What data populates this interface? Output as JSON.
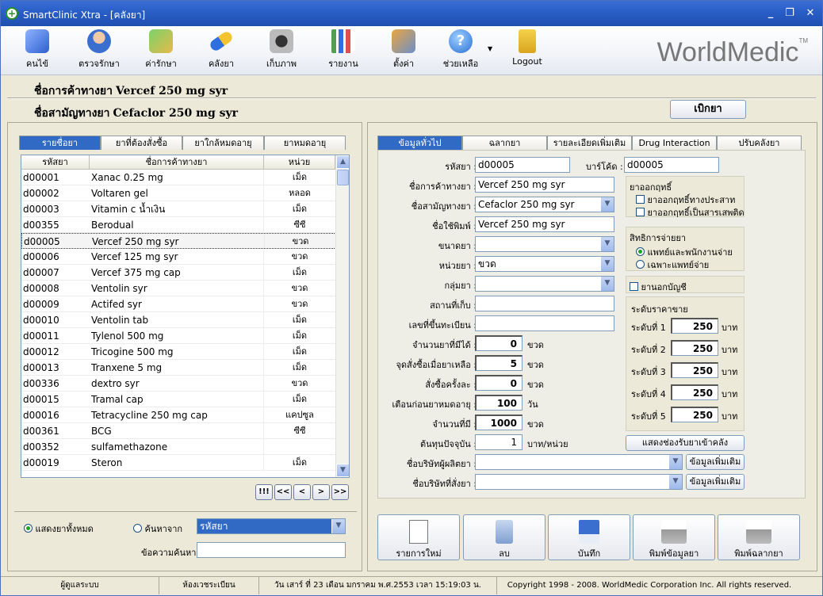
{
  "window": {
    "title": "SmartClinic Xtra - [คลังยา]"
  },
  "toolbar": {
    "items": [
      {
        "label": "คนไข้",
        "icon": "patient-book-icon"
      },
      {
        "label": "ตรวจรักษา",
        "icon": "doctor-icon"
      },
      {
        "label": "ค่ารักษา",
        "icon": "money-icon"
      },
      {
        "label": "คลังยา",
        "icon": "pill-icon"
      },
      {
        "label": "เก็บภาพ",
        "icon": "camera-icon"
      },
      {
        "label": "รายงาน",
        "icon": "bar-chart-icon"
      },
      {
        "label": "ตั้งค่า",
        "icon": "settings-icon"
      },
      {
        "label": "ช่วยเหลือ",
        "icon": "help-icon"
      },
      {
        "label": "Logout",
        "icon": "lock-icon"
      }
    ],
    "logo": "WorldMedic",
    "logo_tm": "TM"
  },
  "header": {
    "trade_label": "ชื่อการค้าทางยา",
    "trade_value": "Vercef 250 mg syr",
    "generic_label": "ชื่อสามัญทางยา",
    "generic_value": "Cefaclor 250 mg syr",
    "dispense_button": "เบิกยา"
  },
  "left": {
    "tabs": [
      "รายชื่อยา",
      "ยาที่ต้องสั่งซื้อ",
      "ยาใกล้หมดอายุ",
      "ยาหมดอายุ"
    ],
    "columns": [
      "รหัสยา",
      "ชื่อการค้าทางยา",
      "หน่วย"
    ],
    "rows": [
      {
        "code": "d00001",
        "name": "Xanac 0.25 mg",
        "unit": "เม็ด"
      },
      {
        "code": "d00002",
        "name": "Voltaren gel",
        "unit": "หลอด"
      },
      {
        "code": "d00003",
        "name": "Vitamin c น้ำเงิน",
        "unit": "เม็ด"
      },
      {
        "code": "d00355",
        "name": "Berodual",
        "unit": "ซีซี"
      },
      {
        "code": "d00005",
        "name": "Vercef 250 mg syr",
        "unit": "ขวด"
      },
      {
        "code": "d00006",
        "name": "Vercef 125 mg syr",
        "unit": "ขวด"
      },
      {
        "code": "d00007",
        "name": "Vercef 375 mg cap",
        "unit": "เม็ด"
      },
      {
        "code": "d00008",
        "name": "Ventolin syr",
        "unit": "ขวด"
      },
      {
        "code": "d00009",
        "name": "Actifed syr",
        "unit": "ขวด"
      },
      {
        "code": "d00010",
        "name": "Ventolin tab",
        "unit": "เม็ด"
      },
      {
        "code": "d00011",
        "name": "Tylenol 500 mg",
        "unit": "เม็ด"
      },
      {
        "code": "d00012",
        "name": "Tricogine 500 mg",
        "unit": "เม็ด"
      },
      {
        "code": "d00013",
        "name": "Tranxene 5 mg",
        "unit": "เม็ด"
      },
      {
        "code": "d00336",
        "name": "dextro syr",
        "unit": "ขวด"
      },
      {
        "code": "d00015",
        "name": "Tramal cap",
        "unit": "เม็ด"
      },
      {
        "code": "d00016",
        "name": "Tetracycline 250 mg cap",
        "unit": "แคปซูล"
      },
      {
        "code": "d00361",
        "name": "BCG",
        "unit": "ซีซี"
      },
      {
        "code": "d00352",
        "name": "sulfamethazone",
        "unit": ""
      },
      {
        "code": "d00019",
        "name": "Steron",
        "unit": "เม็ด"
      }
    ],
    "selected_index": 4,
    "nav": [
      "!!!",
      "<<",
      "<",
      ">",
      ">>"
    ],
    "show_all_label": "แสดงยาทั้งหมด",
    "search_from_label": "ค้นหาจาก",
    "search_from_value": "รหัสยา",
    "search_text_label": "ข้อความค้นหา",
    "search_text_value": ""
  },
  "right": {
    "tabs": [
      "ข้อมูลทั่วไป",
      "ฉลากยา",
      "รายละเอียดเพิ่มเติม",
      "Drug Interaction",
      "ปรับคลังยา"
    ],
    "fields": {
      "code_label": "รหัสยา :",
      "code_value": "d00005",
      "barcode_label": "บาร์โค้ด :",
      "barcode_value": "d00005",
      "trade_label": "ชื่อการค้าทางยา :",
      "trade_value": "Vercef 250 mg syr",
      "generic_label": "ชื่อสามัญทางยา :",
      "generic_value": "Cefaclor 250 mg syr",
      "print_label": "ชื่อใช้พิมพ์ :",
      "print_value": "Vercef 250 mg syr",
      "size_label": "ขนาดยา :",
      "size_value": "",
      "unit_label": "หน่วยยา :",
      "unit_value": "ขวด",
      "group_label": "กลุ่มยา :",
      "group_value": "",
      "location_label": "สถานที่เก็บ :",
      "location_value": "",
      "reg_label": "เลขที่ขึ้นทะเบียน :",
      "reg_value": "",
      "qty_label": "จำนวนยาที่มีได้ :",
      "qty_value": "0",
      "qty_unit": "ขวด",
      "reorder_label": "จุดสั่งซื้อเมื่อยาเหลือ :",
      "reorder_value": "5",
      "reorder_unit": "ขวด",
      "order_label": "สั่งซื้อครั้งละ :",
      "order_value": "0",
      "order_unit": "ขวด",
      "expire_label": "เตือนก่อนยาหมดอายุ :",
      "expire_value": "100",
      "expire_unit": "วัน",
      "have_label": "จำนวนที่มี :",
      "have_value": "1000",
      "have_unit": "ขวด",
      "cost_label": "ต้นทุนปัจจุบัน :",
      "cost_value": "1",
      "cost_unit": "บาท/หน่วย",
      "maker_label": "ชื่อบริษัทผู้ผลิตยา :",
      "maker_value": "",
      "dealer_label": "ชื่อบริษัทที่สั่งยา :",
      "dealer_value": "",
      "more_info_1": "ข้อมูลเพิ่มเติม",
      "more_info_2": "ข้อมูลเพิ่มเติม"
    },
    "narcotic": {
      "title": "ยาออกฤทธิ์",
      "opt1": "ยาออกฤทธิ์ทางประสาท",
      "opt2": "ยาออกฤทธิ์เป็นสารเสพติด"
    },
    "rights": {
      "title": "สิทธิการจ่ายยา",
      "opt1": "แพทย์และพนักงานจ่าย",
      "opt2": "เฉพาะแพทย์จ่าย"
    },
    "off_list": "ยานอกบัญชี",
    "price": {
      "title": "ระดับราคาขาย",
      "levels": [
        {
          "label": "ระดับที่ 1",
          "value": "250",
          "unit": "บาท"
        },
        {
          "label": "ระดับที่ 2",
          "value": "250",
          "unit": "บาท"
        },
        {
          "label": "ระดับที่ 3",
          "value": "250",
          "unit": "บาท"
        },
        {
          "label": "ระดับที่ 4",
          "value": "250",
          "unit": "บาท"
        },
        {
          "label": "ระดับที่ 5",
          "value": "250",
          "unit": "บาท"
        }
      ],
      "receive_button": "แสดงช่องรับยาเข้าคลัง"
    },
    "actions": [
      {
        "label": "รายการใหม่",
        "icon": "new-document-icon"
      },
      {
        "label": "ลบ",
        "icon": "recycle-bin-icon"
      },
      {
        "label": "บันทึก",
        "icon": "save-disk-icon"
      },
      {
        "label": "พิมพ์ข้อมูลยา",
        "icon": "printer-icon"
      },
      {
        "label": "พิมพ์ฉลากยา",
        "icon": "printer-icon"
      }
    ]
  },
  "status": {
    "user": "ผู้ดูแลระบบ",
    "room": "ห้องเวชระเบียน",
    "datetime": "วัน เสาร์ ที่ 23 เดือน มกราคม พ.ศ.2553 เวลา 15:19:03 น.",
    "copyright": "Copyright 1998 - 2008. WorldMedic Corporation Inc. All rights reserved."
  }
}
